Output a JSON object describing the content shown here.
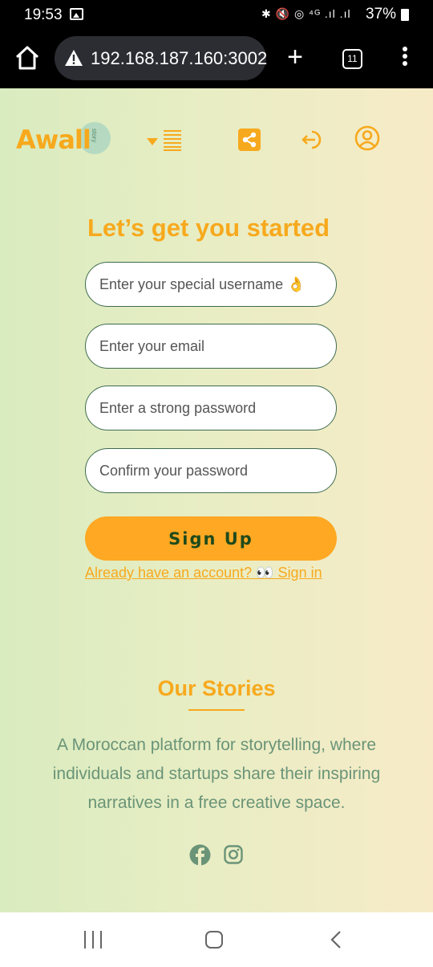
{
  "status_bar": {
    "time": "19:53",
    "indicators": "✱ 🔇 ◎ ⁴ᴳ .ıl .ıl",
    "battery": "37%"
  },
  "browser": {
    "url": "192.168.187.160:3002",
    "tab_count": "11",
    "icons": [
      "home-icon",
      "warning-icon",
      "plus-icon",
      "tabs-icon",
      "more-vert-icon"
    ]
  },
  "nav": {
    "logo_text": "Awall",
    "logo_tag": "story",
    "icons": [
      "caret-down-icon",
      "list-icon",
      "share-icon",
      "logout-icon",
      "user-circle-icon"
    ],
    "accent_color": "#f7a91d"
  },
  "form": {
    "heading": "Let’s get you started",
    "username_placeholder": "Enter your special username 👌",
    "email_placeholder": "Enter your email",
    "password_placeholder": "Enter a strong password",
    "confirm_placeholder": "Confirm your password",
    "submit_label": "Sign Up",
    "signin_link": "Already have an account? 👀 Sign in",
    "button_color": "#fea823"
  },
  "footer": {
    "title": "Our Stories",
    "description": "A Moroccan platform for storytelling, where individuals and startups share their inspiring narratives in a free creative space.",
    "social_icons": [
      "facebook-icon",
      "instagram-icon"
    ],
    "text_color": "#6a9478"
  },
  "android_nav": {
    "icons": [
      "recents-icon",
      "home-icon",
      "back-icon"
    ]
  }
}
